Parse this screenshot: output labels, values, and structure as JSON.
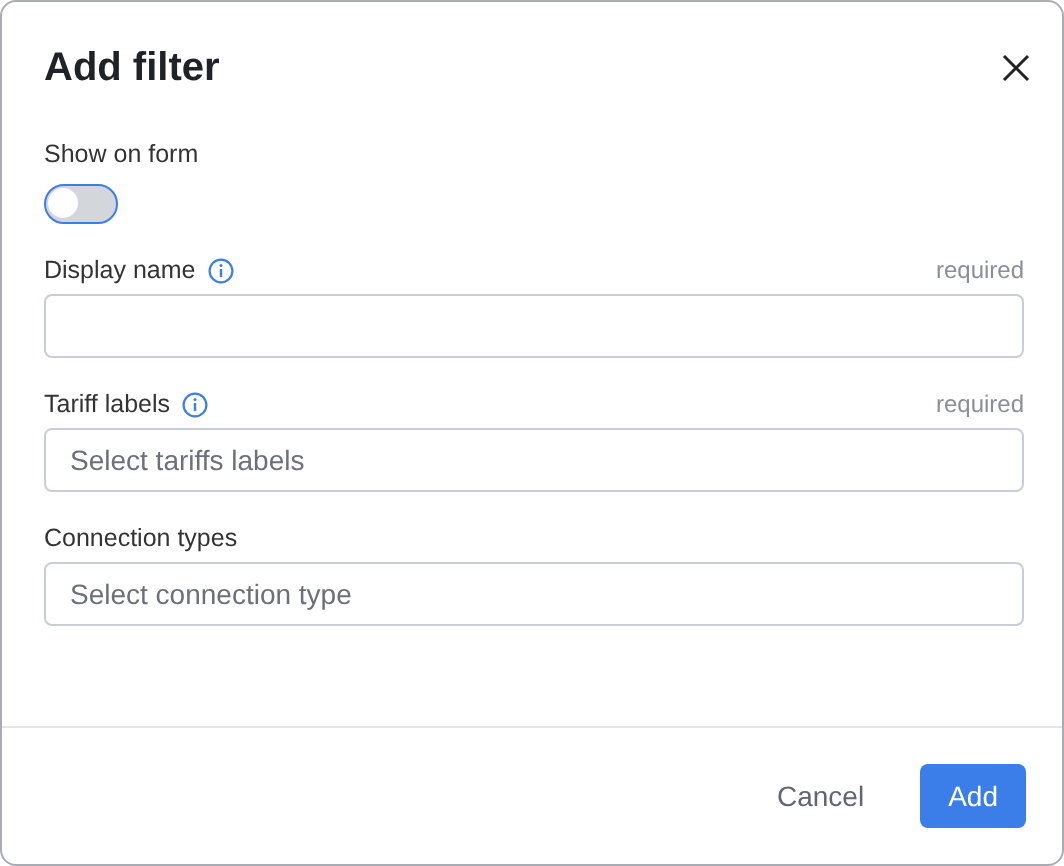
{
  "dialog": {
    "title": "Add filter",
    "toggle": {
      "label": "Show on form",
      "on": false
    },
    "fields": [
      {
        "label": "Display name",
        "info": true,
        "note": "required"
      },
      {
        "label": "Tariff labels",
        "info": true,
        "note": "required",
        "placeholder": "Select tariffs labels"
      },
      {
        "label": "Connection types",
        "info": false,
        "placeholder": "Select connection type"
      }
    ],
    "buttons": [
      {
        "label": "Cancel",
        "kind": "secondary"
      },
      {
        "label": "Add",
        "kind": "primary"
      }
    ]
  }
}
